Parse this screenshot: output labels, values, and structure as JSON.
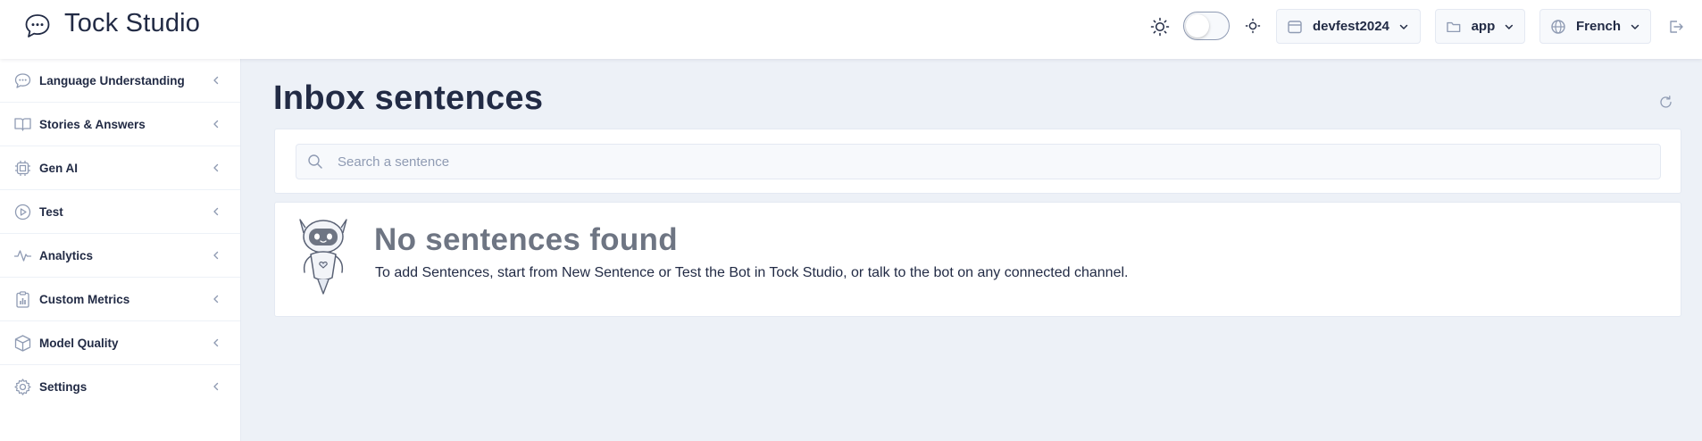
{
  "header": {
    "app_title": "Tock Studio",
    "namespace": "devfest2024",
    "application": "app",
    "locale": "French",
    "theme_dark_enabled": false
  },
  "icons": {
    "logo": "chat-bubble-icon",
    "theme_light": "sun-icon",
    "theme_dark": "small-sun-icon",
    "namespace": "calendar-icon",
    "application": "folder-icon",
    "locale": "globe-icon",
    "logout": "logout-icon",
    "refresh": "refresh-icon",
    "search": "search-icon"
  },
  "sidebar": {
    "items": [
      {
        "label": "Language Understanding",
        "icon": "chat-bubble-icon"
      },
      {
        "label": "Stories & Answers",
        "icon": "book-icon"
      },
      {
        "label": "Gen AI",
        "icon": "cpu-icon"
      },
      {
        "label": "Test",
        "icon": "play-circle-icon"
      },
      {
        "label": "Analytics",
        "icon": "activity-icon"
      },
      {
        "label": "Custom Metrics",
        "icon": "clipboard-chart-icon"
      },
      {
        "label": "Model Quality",
        "icon": "box-icon"
      },
      {
        "label": "Settings",
        "icon": "gear-icon"
      }
    ]
  },
  "main": {
    "title": "Inbox sentences",
    "search_placeholder": "Search a sentence",
    "empty_title": "No sentences found",
    "empty_text": "To add Sentences, start from New Sentence or Test the Bot in Tock Studio, or talk to the bot on any connected channel."
  },
  "colors": {
    "text_primary": "#222b45",
    "text_hint": "#8f9bb3",
    "background": "#edf1f7",
    "card": "#ffffff",
    "empty_title": "#6e7583"
  }
}
